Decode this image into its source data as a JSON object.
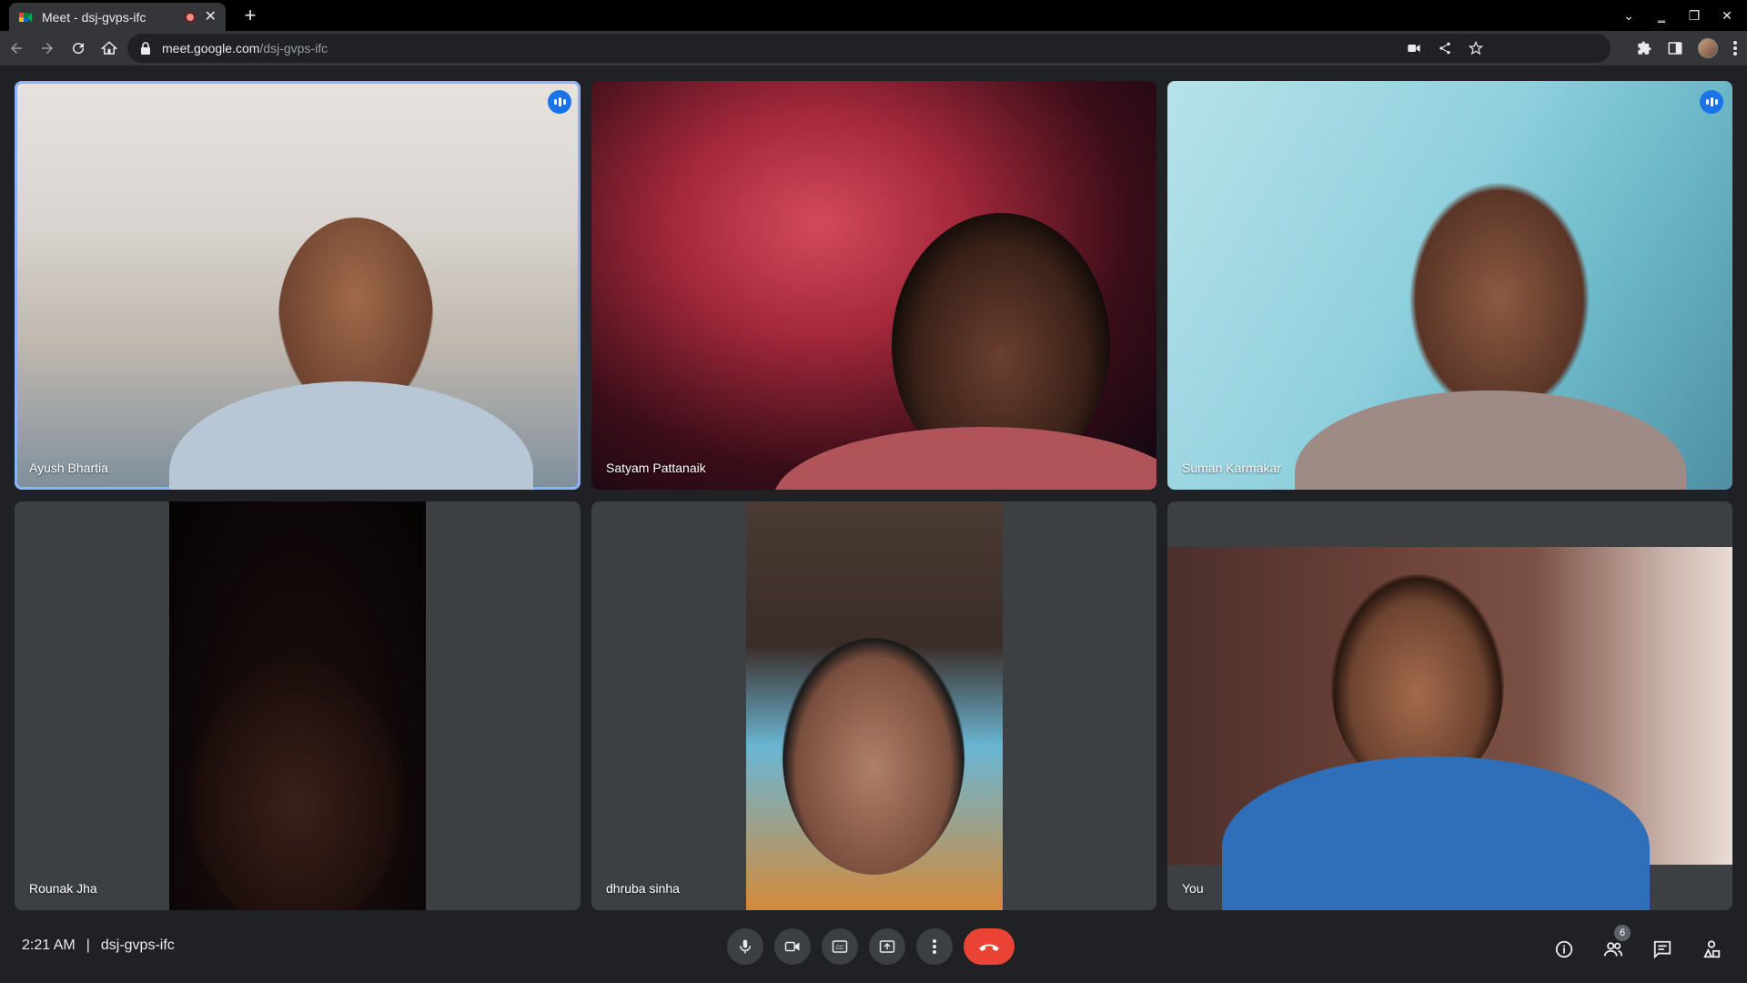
{
  "browser": {
    "tab": {
      "title": "Meet - dsj-gvps-ifc"
    },
    "url": {
      "host": "meet.google.com",
      "path": "/dsj-gvps-ifc"
    }
  },
  "participants": [
    {
      "name": "Ayush Bhartia",
      "speaking": true
    },
    {
      "name": "Satyam Pattanaik",
      "speaking": false
    },
    {
      "name": "Suman Karmakar",
      "speaking": true
    },
    {
      "name": "Rounak Jha",
      "speaking": false
    },
    {
      "name": "dhruba sinha",
      "speaking": false
    },
    {
      "name": "You",
      "speaking": false
    }
  ],
  "bottom_bar": {
    "time": "2:21 AM",
    "separator": "|",
    "meeting_code": "dsj-gvps-ifc",
    "people_count": "6"
  },
  "icons": {
    "tab": [
      "meet-favicon-icon",
      "recording-dot-icon",
      "close-icon",
      "plus-icon"
    ],
    "toolbar": [
      "back-icon",
      "forward-icon",
      "reload-icon",
      "home-icon",
      "lock-icon",
      "camera-icon",
      "share-icon",
      "star-icon",
      "extensions-icon",
      "sidepanel-icon",
      "profile-avatar",
      "menu-icon"
    ],
    "controls": [
      "mic-icon",
      "camera-icon",
      "captions-icon",
      "present-icon",
      "more-options-icon",
      "end-call-icon"
    ],
    "right": [
      "info-icon",
      "people-icon",
      "chat-icon",
      "activities-icon"
    ]
  },
  "colors": {
    "accent": "#8ab4f8",
    "speaking": "#1a73e8",
    "end_call": "#ea4335",
    "background": "#202124",
    "tile": "#3c4043"
  }
}
